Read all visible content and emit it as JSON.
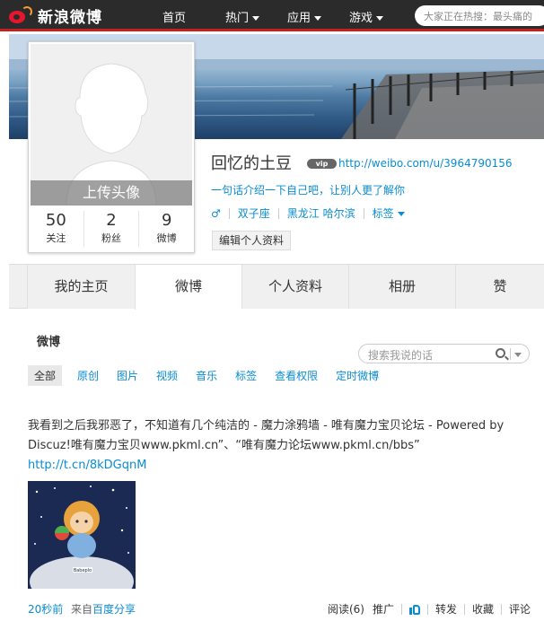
{
  "topnav": {
    "logo_text": "新浪微博",
    "links": [
      {
        "label": "首页",
        "has_caret": false
      },
      {
        "label": "热门",
        "has_caret": true
      },
      {
        "label": "应用",
        "has_caret": true
      },
      {
        "label": "游戏",
        "has_caret": true
      }
    ],
    "search_placeholder": "大家正在热搜：最头痛的"
  },
  "profile": {
    "upload_avatar_label": "上传头像",
    "stats": [
      {
        "value": "50",
        "label": "关注"
      },
      {
        "value": "2",
        "label": "粉丝"
      },
      {
        "value": "9",
        "label": "微博"
      }
    ],
    "name": "回忆的土豆",
    "badge_text": "vip",
    "url": "http://weibo.com/u/3964790156",
    "intro": "一句话介绍一下自己吧，让别人更了解你",
    "gender_icon": "♂",
    "zodiac": "双子座",
    "location": "黑龙江 哈尔滨",
    "tags_label": "标签",
    "edit_button": "编辑个人资料"
  },
  "tabs": [
    "我的主页",
    "微博",
    "个人资料",
    "相册",
    "赞"
  ],
  "active_tab": 1,
  "feed": {
    "title": "微博",
    "search_placeholder": "搜索我说的话",
    "filters": [
      "全部",
      "原创",
      "图片",
      "视频",
      "音乐",
      "标签",
      "查看权限",
      "定时微博"
    ]
  },
  "post": {
    "text": "我看到之后我邪恶了，不知道有几个纯洁的 - 魔力涂鸦墙 - 唯有魔力宝贝论坛 - Powered by Discuz!唯有魔力宝贝www.pkml.cn”、“唯有魔力论坛www.pkml.cn/bbs”",
    "link": "http://t.cn/8kDGqnM",
    "image_caption": "Babeplo",
    "time": "20秒前",
    "source_prefix": "来自",
    "source_name": "百度分享",
    "actions": {
      "read": "阅读(6)",
      "promote": "推广",
      "forward": "转发",
      "favorite": "收藏",
      "comment": "评论"
    }
  },
  "colors": {
    "link": "#0a8cd2",
    "nav_bg": "#2b2b2b",
    "brand_red": "#e6162d"
  }
}
